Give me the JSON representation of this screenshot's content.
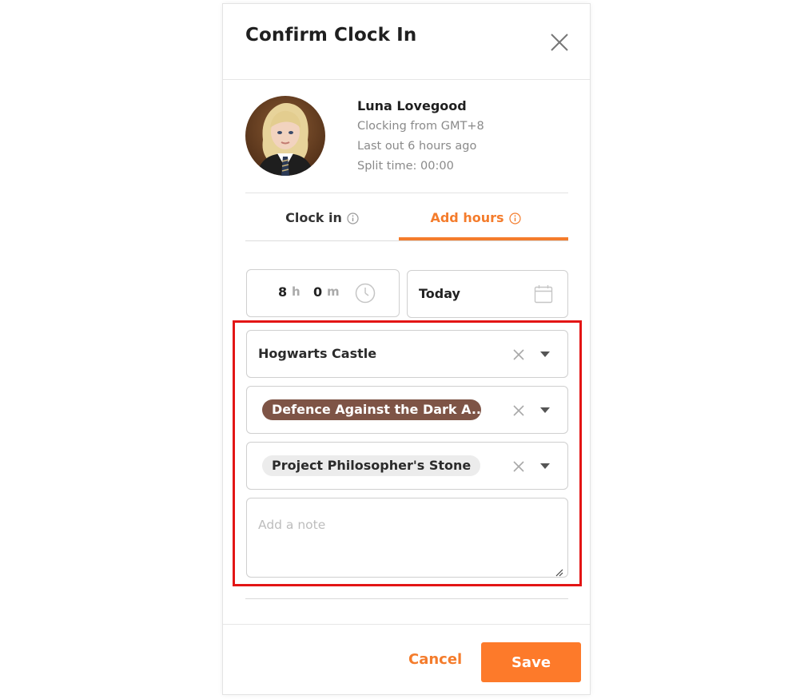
{
  "dialog": {
    "title": "Confirm Clock In"
  },
  "user": {
    "name": "Luna Lovegood",
    "timezone_line": "Clocking from GMT+8",
    "last_out_line": "Last out 6 hours ago",
    "split_time_line": "Split time: 00:00"
  },
  "tabs": [
    {
      "label": "Clock in",
      "active": false
    },
    {
      "label": "Add hours",
      "active": true
    }
  ],
  "duration": {
    "hours": "8",
    "hours_unit": "h",
    "minutes": "0",
    "minutes_unit": "m"
  },
  "date": {
    "value": "Today"
  },
  "fields": {
    "location": "Hogwarts Castle",
    "activity": "Defence Against the Dark A...",
    "project": "Project Philosopher's Stone",
    "note_placeholder": "Add a note"
  },
  "footer": {
    "cancel_label": "Cancel",
    "save_label": "Save"
  },
  "colors": {
    "accent": "#f47c2c",
    "save_button": "#fd7a2a",
    "activity_chip": "#7e5446",
    "project_chip": "#ececec",
    "highlight_border": "#e31515"
  }
}
